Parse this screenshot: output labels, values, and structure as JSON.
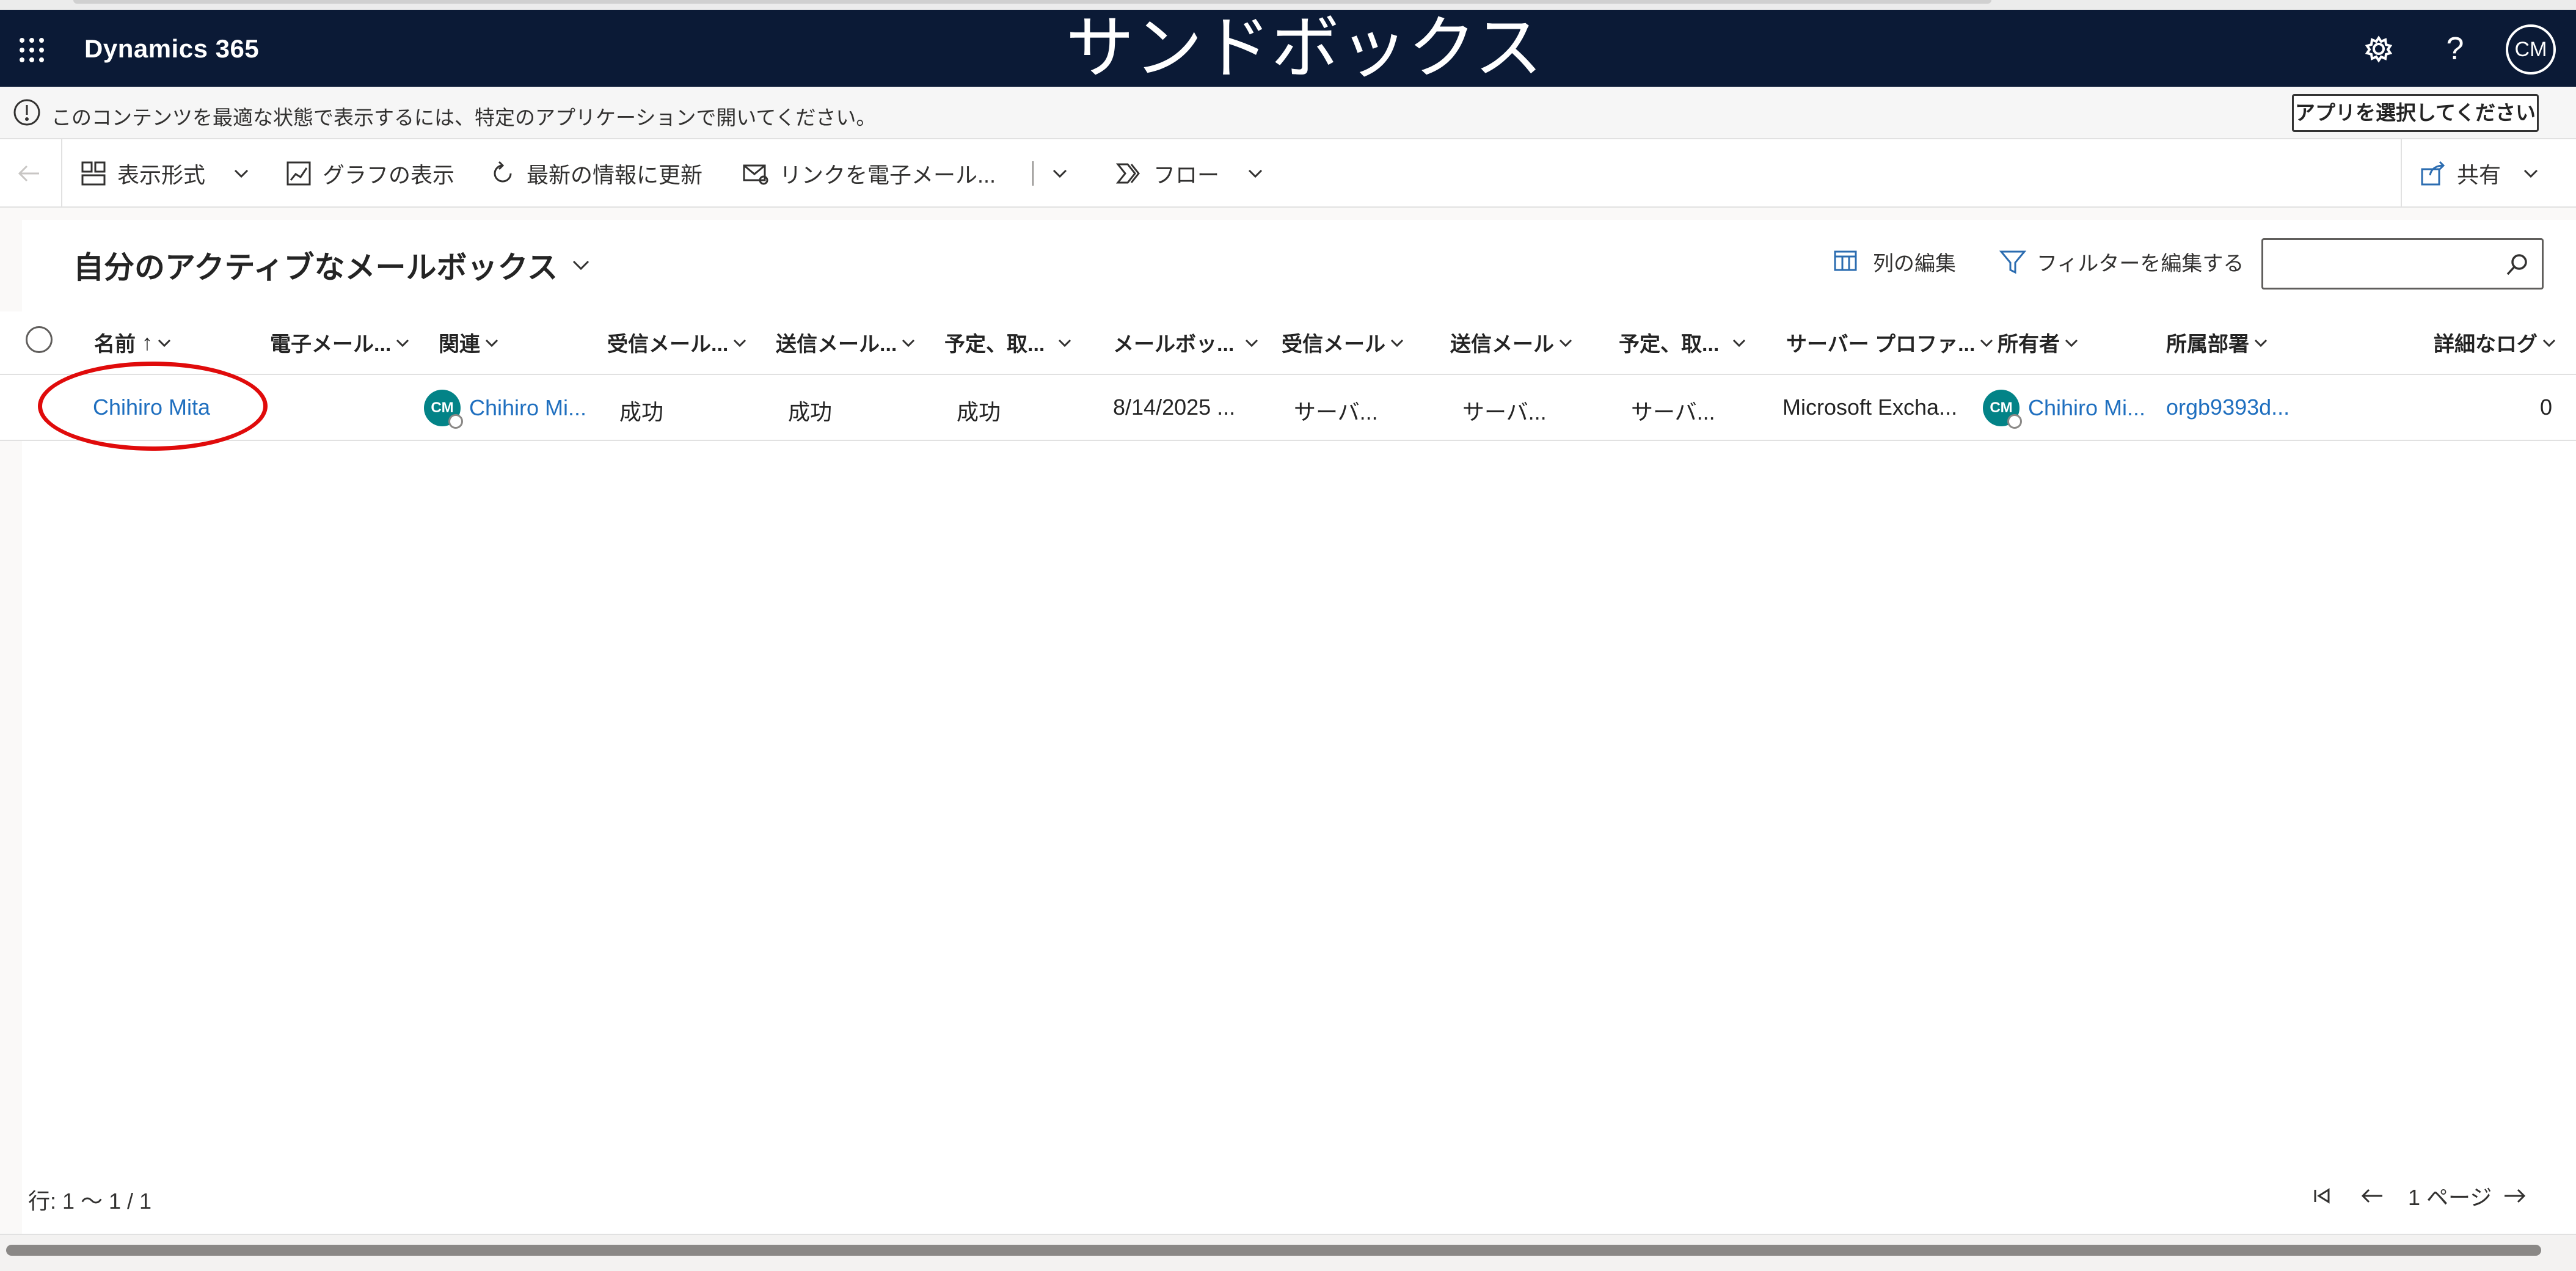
{
  "nav": {
    "app_name": "Dynamics 365",
    "overlay_title": "サンドボックス",
    "help_label": "?",
    "user_initials": "CM",
    "bg_color": "#0b1a36"
  },
  "banner": {
    "message": "このコンテンツを最適な状態で表示するには、特定のアプリケーションで開いてください。",
    "button_label": "アプリを選択してください"
  },
  "commands": {
    "view_format": "表示形式",
    "show_chart": "グラフの表示",
    "refresh": "最新の情報に更新",
    "email_link": "リンクを電子メール...",
    "flow": "フロー",
    "share": "共有"
  },
  "view": {
    "title": "自分のアクティブなメールボックス",
    "edit_columns": "列の編集",
    "edit_filters": "フィルターを編集する",
    "search_placeholder": ""
  },
  "columns": [
    "名前",
    "電子メール...",
    "関連",
    "受信メール...",
    "送信メール...",
    "予定、取...",
    "メールボッ...",
    "受信メール",
    "送信メール",
    "予定、取...",
    "サーバー プロファ...",
    "所有者",
    "所属部署",
    "詳細なログ"
  ],
  "sort_indicator": "↑",
  "rows": [
    {
      "name": "Chihiro Mita",
      "email": "",
      "regarding": "Chihiro Mi...",
      "regarding_initials": "CM",
      "incoming_status": "成功",
      "outgoing_status": "成功",
      "appointments_status": "成功",
      "mailbox_date": "8/14/2025 ...",
      "incoming_mail": "サーバ...",
      "outgoing_mail": "サーバ...",
      "appointments": "サーバ...",
      "server_profile": "Microsoft Excha...",
      "owner": "Chihiro Mi...",
      "owner_initials": "CM",
      "business_unit": "orgb9393d...",
      "detailed_log": "0"
    }
  ],
  "footer": {
    "row_count": "行: 1 〜 1 / 1",
    "page_label": "1 ページ"
  },
  "colors": {
    "link": "#1f6fbf",
    "persona": "#038387",
    "annotation": "#e00b0b"
  }
}
